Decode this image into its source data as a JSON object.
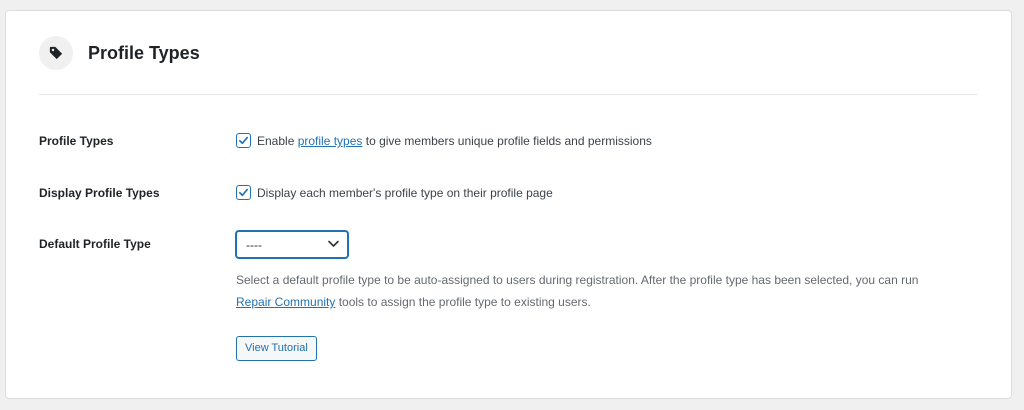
{
  "header": {
    "title": "Profile Types",
    "icon": "tag-icon"
  },
  "rows": {
    "profile_types": {
      "label": "Profile Types",
      "checked": true,
      "text_before": "Enable ",
      "link_text": "profile types",
      "text_after": " to give members unique profile fields and permissions"
    },
    "display_profile_types": {
      "label": "Display Profile Types",
      "checked": true,
      "text": "Display each member's profile type on their profile page"
    },
    "default_profile_type": {
      "label": "Default Profile Type",
      "select_value": "----",
      "help_line1": "Select a default profile type to be auto-assigned to users during registration. After the profile type has been selected, you can run",
      "help_link": "Repair Community",
      "help_line2_after": " tools to assign the profile type to existing users.",
      "button_label": "View Tutorial"
    }
  },
  "colors": {
    "accent": "#2271b1",
    "background": "#f0f0f1",
    "card": "#ffffff",
    "muted_text": "#646970"
  }
}
